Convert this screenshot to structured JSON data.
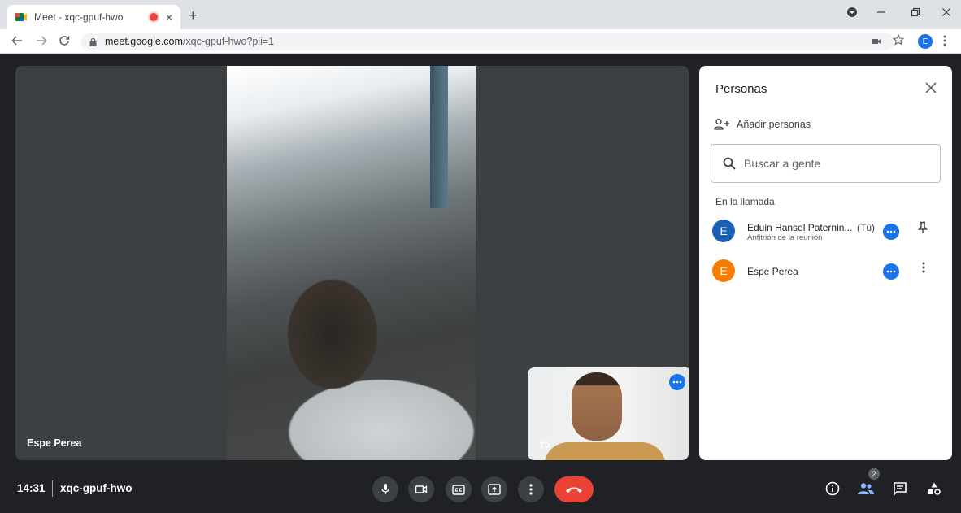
{
  "browser": {
    "tab_title": "Meet - xqc-gpuf-hwo",
    "tab_close": "×",
    "new_tab": "+",
    "url_host": "meet.google.com",
    "url_path": "/xqc-gpuf-hwo?pli=1",
    "profile_initial": "E"
  },
  "stage": {
    "main_participant_name": "Espe Perea",
    "self_label": "Tú"
  },
  "panel": {
    "title": "Personas",
    "add_people_label": "Añadir personas",
    "search_placeholder": "Buscar a gente",
    "section_label": "En la llamada",
    "participants": [
      {
        "initial": "E",
        "name": "Eduin Hansel Paternin...",
        "tag": "(Tú)",
        "subtitle": "Anfitrión de la reunión",
        "avatar_color": "#1a5fb4"
      },
      {
        "initial": "E",
        "name": "Espe Perea",
        "tag": "",
        "subtitle": "",
        "avatar_color": "#f57c00"
      }
    ]
  },
  "bottom": {
    "time": "14:31",
    "meeting_code": "xqc-gpuf-hwo",
    "people_count": "2"
  },
  "colors": {
    "accent_blue": "#1a73e8",
    "end_call_red": "#ea4335",
    "background": "#202124"
  }
}
